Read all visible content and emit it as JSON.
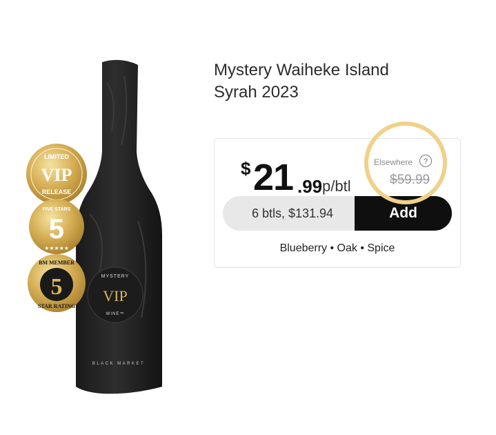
{
  "product": {
    "title_line1": "Mystery Waiheke Island",
    "title_line2": "Syrah 2023",
    "image": {
      "bottle_brand": "BLACK MARKET",
      "label_top": "MYSTERY",
      "label_main": "VIP",
      "label_bottom": "WINE™",
      "badges": [
        {
          "top": "LIMITED",
          "main": "VIP",
          "bottom": "RELEASE"
        },
        {
          "top": "FIVE STARS",
          "main": "5"
        },
        {
          "top": "BM MEMBER",
          "main": "5",
          "bottom": "STAR RATING"
        }
      ]
    }
  },
  "pricing": {
    "currency": "$",
    "dollars": "21",
    "cents": ".99",
    "per_unit": "p/btl",
    "elsewhere_label": "Elsewhere",
    "help_icon": "?",
    "elsewhere_price": "$59.99",
    "highlight_color": "#efd189"
  },
  "purchase": {
    "bundle_label": "6 btls, $131.94",
    "add_label": "Add"
  },
  "tasting_notes": "Blueberry • Oak • Spice"
}
